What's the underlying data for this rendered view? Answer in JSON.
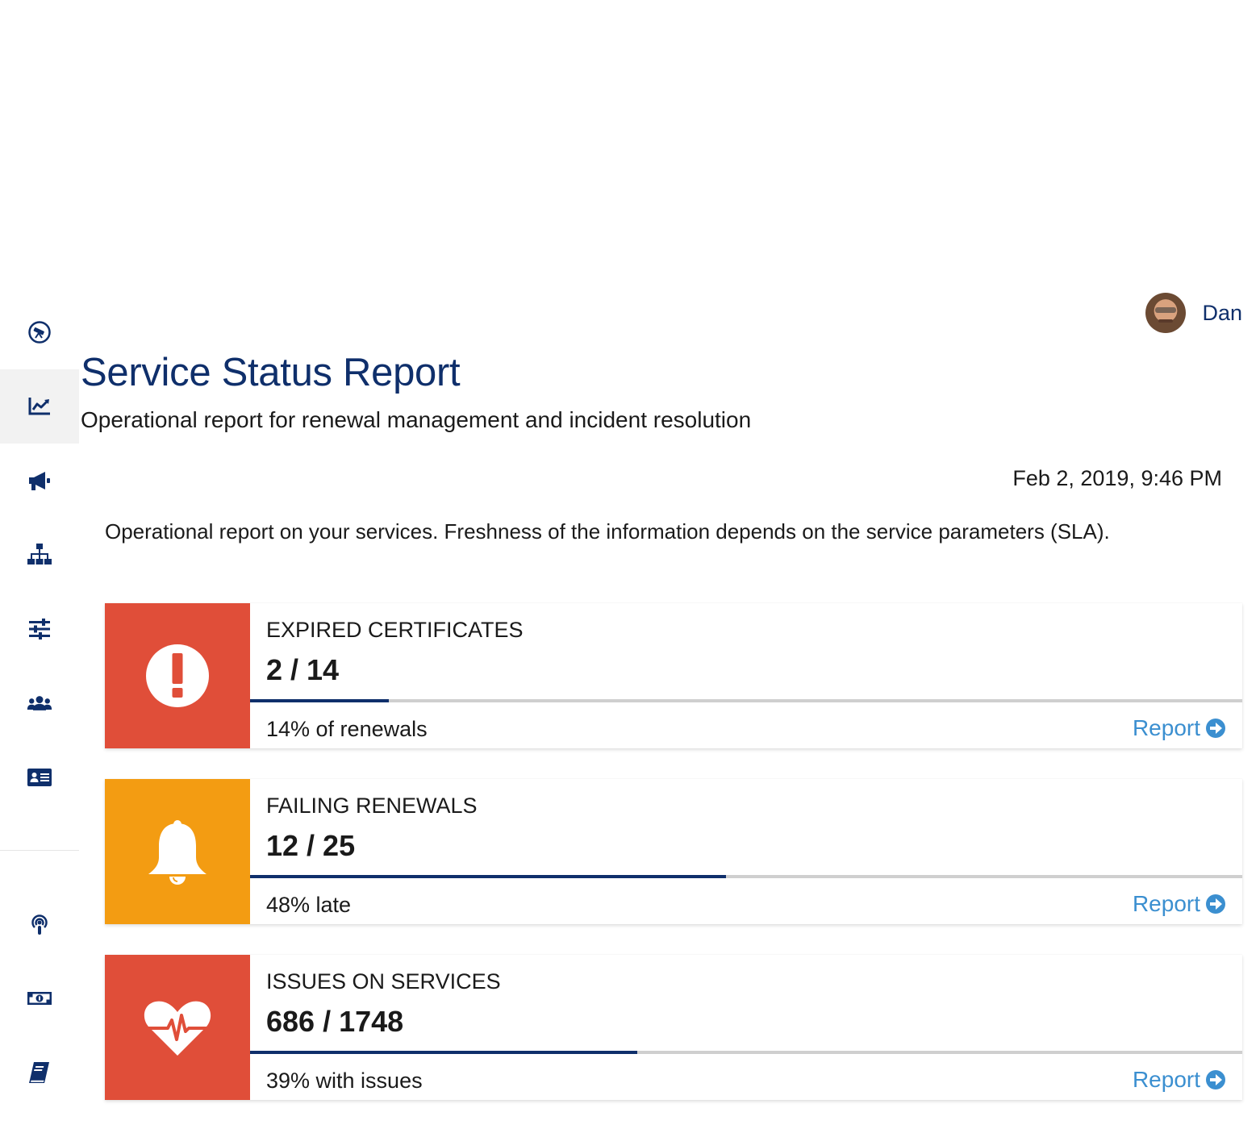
{
  "user": {
    "name": "Dan"
  },
  "header": {
    "title": "Service Status Report",
    "subtitle": "Operational report for renewal management and incident resolution"
  },
  "timestamp": "Feb 2, 2019, 9:46 PM",
  "intro": "Operational report on your services. Freshness of the information depends on the service parameters (SLA).",
  "sidebar": {
    "items": [
      {
        "icon": "telescope-icon"
      },
      {
        "icon": "chart-line-icon",
        "active": true
      },
      {
        "icon": "megaphone-icon"
      },
      {
        "icon": "sitemap-icon"
      },
      {
        "icon": "sliders-icon"
      },
      {
        "icon": "users-icon"
      },
      {
        "icon": "id-card-icon"
      },
      {
        "icon": "podcast-icon"
      },
      {
        "icon": "money-bill-icon"
      },
      {
        "icon": "book-icon"
      }
    ]
  },
  "colors": {
    "primary": "#0f2f6b",
    "danger": "#e04e39",
    "warning": "#f39c12",
    "link": "#3b8fd0",
    "progress_track": "#cfcfcf"
  },
  "cards": [
    {
      "title": "EXPIRED CERTIFICATES",
      "value": "2 / 14",
      "progress": 0.14,
      "description": "14% of renewals",
      "link_label": "Report",
      "icon": "exclamation-circle-icon",
      "color": "#e04e39"
    },
    {
      "title": "FAILING RENEWALS",
      "value": "12 / 25",
      "progress": 0.48,
      "description": "48% late",
      "link_label": "Report",
      "icon": "bell-icon",
      "color": "#f39c12"
    },
    {
      "title": "ISSUES ON SERVICES",
      "value": "686 / 1748",
      "progress": 0.39,
      "description": "39% with issues",
      "link_label": "Report",
      "icon": "heartbeat-icon",
      "color": "#e04e39"
    }
  ]
}
